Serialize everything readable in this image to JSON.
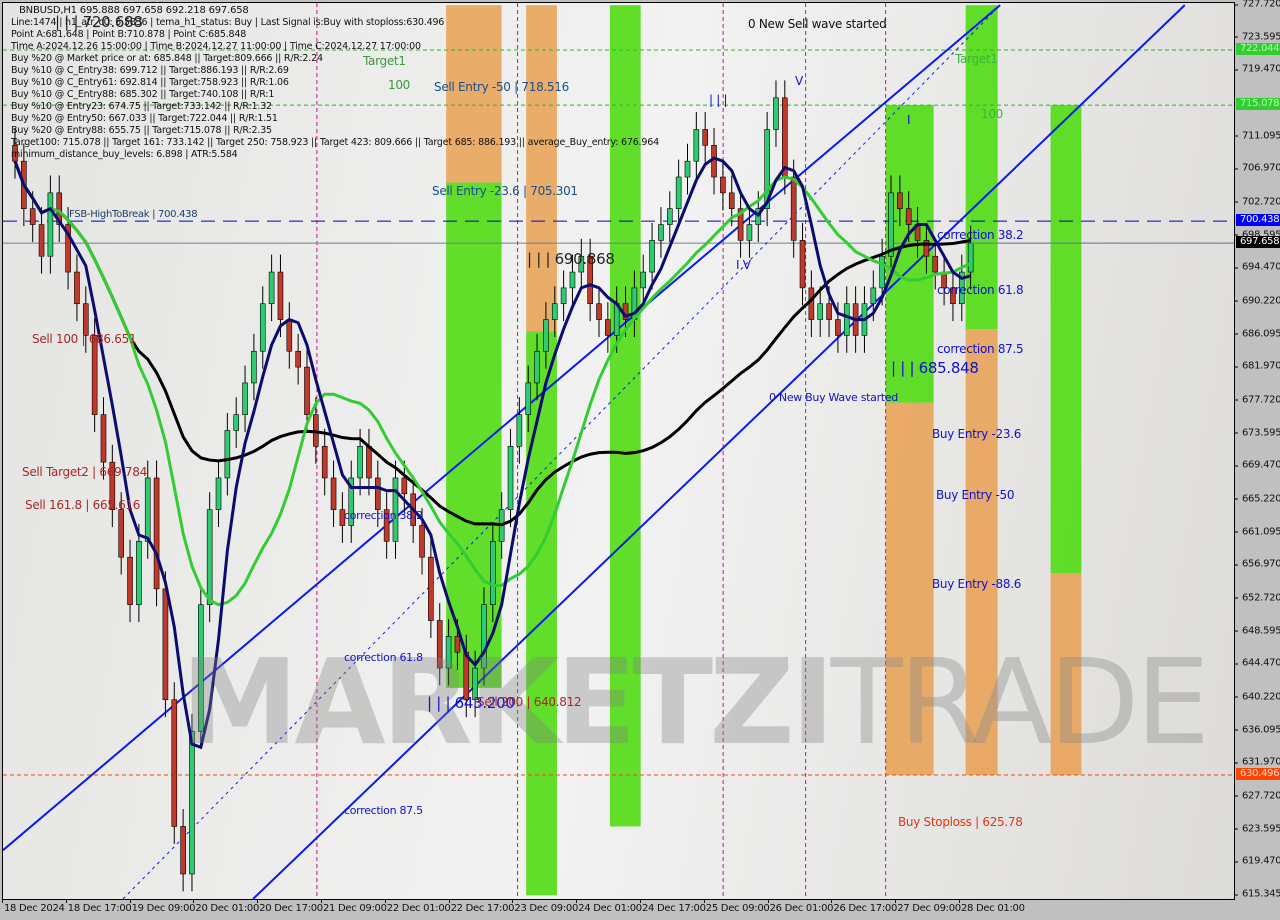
{
  "chart_data": {
    "type": "candlestick",
    "title": "BNBUSD,H1  695.888 697.658 692.218 697.658",
    "symbol": "BNBUSD",
    "timeframe": "H1",
    "ohlc_current": {
      "open": 695.888,
      "high": 697.658,
      "low": 692.218,
      "close": 697.658
    },
    "ylim": [
      615.345,
      727.72
    ],
    "y_ticks": [
      "727.720",
      "723.595",
      "719.470",
      "711.095",
      "706.970",
      "702.720",
      "698.595",
      "694.470",
      "690.220",
      "686.095",
      "681.970",
      "677.720",
      "673.595",
      "669.470",
      "665.220",
      "661.095",
      "656.970",
      "652.720",
      "648.595",
      "644.470",
      "640.220",
      "636.095",
      "631.970",
      "627.720",
      "623.595",
      "619.470",
      "615.345"
    ],
    "x_ticks": [
      "18 Dec 2024",
      "18 Dec 17:00",
      "19 Dec 09:00",
      "20 Dec 01:00",
      "20 Dec 17:00",
      "21 Dec 09:00",
      "22 Dec 01:00",
      "22 Dec 17:00",
      "23 Dec 09:00",
      "24 Dec 01:00",
      "24 Dec 17:00",
      "25 Dec 09:00",
      "26 Dec 01:00",
      "26 Dec 17:00",
      "27 Dec 09:00",
      "28 Dec 01:00"
    ],
    "price_badges": [
      {
        "value": "722.044",
        "color": "#33cc33",
        "text_color": "#aaffaa"
      },
      {
        "value": "715.078",
        "color": "#33cc33",
        "text_color": "#aaffaa"
      },
      {
        "value": "700.438",
        "color": "#0000ff",
        "text_color": "#ffffff"
      },
      {
        "value": "697.658",
        "color": "#000000",
        "text_color": "#ffffff"
      },
      {
        "value": "630.496",
        "color": "#ff4400",
        "text_color": "#ffdddd"
      }
    ],
    "horizontal_lines": [
      {
        "name": "target-722",
        "value": 722.044,
        "color": "#22bb22",
        "style": "dashed"
      },
      {
        "name": "target-715",
        "value": 715.078,
        "color": "#22bb22",
        "style": "dashed"
      },
      {
        "name": "fsb-high-to-break",
        "value": 700.438,
        "color": "#0000cc",
        "style": "longdash"
      },
      {
        "name": "last-price",
        "value": 697.658,
        "color": "#708090",
        "style": "solid"
      },
      {
        "name": "stoploss",
        "value": 630.496,
        "color": "#ff4400",
        "style": "dashed"
      }
    ],
    "close_series_approx": [
      708,
      702,
      700,
      696,
      704,
      700,
      694,
      690,
      686,
      676,
      670,
      664,
      658,
      652,
      660,
      668,
      654,
      640,
      624,
      618,
      636,
      652,
      664,
      668,
      674,
      676,
      680,
      684,
      690,
      694,
      688,
      684,
      682,
      676,
      672,
      668,
      664,
      662,
      668,
      672,
      668,
      664,
      660,
      668,
      666,
      662,
      658,
      650,
      644,
      648,
      646,
      640,
      644,
      652,
      660,
      664,
      672,
      676,
      680,
      684,
      688,
      690,
      692,
      694,
      696,
      690,
      688,
      686,
      690,
      688,
      692,
      694,
      698,
      700,
      702,
      706,
      708,
      712,
      710,
      706,
      704,
      702,
      698,
      700,
      702,
      712,
      716,
      706,
      698,
      692,
      688,
      690,
      688,
      686,
      690,
      686,
      690,
      692,
      696,
      704,
      702,
      700,
      698,
      696,
      694,
      692,
      690,
      694,
      697.658
    ],
    "zones": [
      {
        "name": "sell-zone-1",
        "color": "orange",
        "from_x": 0.36,
        "to_x": 0.405,
        "from_y": 727.7,
        "to_y": 705.3
      },
      {
        "name": "sell-zone-1-green",
        "color": "green",
        "from_x": 0.36,
        "to_x": 0.405,
        "from_y": 705.3,
        "to_y": 641.5
      },
      {
        "name": "sell-zone-2",
        "color": "orange",
        "from_x": 0.425,
        "to_x": 0.45,
        "from_y": 727.7,
        "to_y": 686.5
      },
      {
        "name": "sell-zone-2-green",
        "color": "green",
        "from_x": 0.425,
        "to_x": 0.45,
        "from_y": 686.5,
        "to_y": 615.3
      },
      {
        "name": "green-band-3",
        "color": "green",
        "from_x": 0.493,
        "to_x": 0.518,
        "from_y": 727.7,
        "to_y": 624
      },
      {
        "name": "buy-zone-1-green",
        "color": "green",
        "from_x": 0.717,
        "to_x": 0.756,
        "from_y": 715.1,
        "to_y": 677.5
      },
      {
        "name": "buy-zone-1",
        "color": "orange",
        "from_x": 0.717,
        "to_x": 0.756,
        "from_y": 677.5,
        "to_y": 630.5
      },
      {
        "name": "buy-zone-2-green",
        "color": "green",
        "from_x": 0.782,
        "to_x": 0.808,
        "from_y": 727.7,
        "to_y": 686.8
      },
      {
        "name": "buy-zone-2",
        "color": "orange",
        "from_x": 0.782,
        "to_x": 0.808,
        "from_y": 686.8,
        "to_y": 630.5
      },
      {
        "name": "buy-zone-3-green",
        "color": "green",
        "from_x": 0.851,
        "to_x": 0.876,
        "from_y": 715.1,
        "to_y": 656
      },
      {
        "name": "buy-zone-3",
        "color": "orange",
        "from_x": 0.851,
        "to_x": 0.876,
        "from_y": 656,
        "to_y": 630.5
      }
    ]
  },
  "info_panel": {
    "line1": "Line:1474 | h1_atr_c0: 5.5836 | tema_h1_status: Buy | Last Signal is:Buy with stoploss:630.496",
    "line2": "Point A:681.648 | Point B:710.878 | Point C:685.848",
    "line3": "Time A:2024.12.26 15:00:00 | Time B:2024.12.27 11:00:00 | Time C:2024.12.27 17:00:00",
    "line4": "Buy %20 @ Market price or at: 685.848 || Target:809.666 || R/R:2.24",
    "line5": "Buy %10 @ C_Entry38: 699.712 || Target:886.193 || R/R:2.69",
    "line6": "Buy %10 @ C_Entry61: 692.814 || Target:758.923 || R/R:1.06",
    "line7": "Buy %10 @ C_Entry88: 685.302 || Target:740.108 || R/R:1",
    "line8": "Buy %10 @ Entry23: 674.75 || Target:733.142 || R/R:1.32",
    "line9": "Buy %20 @ Entry50: 667.033 || Target:722.044 || R/R:1.51",
    "line10": "Buy %20 @ Entry88: 655.75 || Target:715.078 || R/R:2.35",
    "line11": "Target100: 715.078 || Target 161: 733.142 || Target 250: 758.923 || Target 423: 809.666 || Target 685: 886.193 || average_Buy_entry: 676.964",
    "line12": "minimum_distance_buy_levels: 6.898 | ATR:5.584"
  },
  "labels": {
    "top_wave_label": "| | | 720.688",
    "target1_left": "Target1",
    "target1_right": "Target1",
    "level100_left": "100",
    "level100_right": "100",
    "sell_entry_50": "Sell Entry -50 | 718.516",
    "sell_entry_23": "Sell Entry -23.6 | 705.301",
    "fsb_high": "FSB-HighToBreak | 700.438",
    "wave_690": "| | | 690.868",
    "sell_100": "Sell 100 | 686.651",
    "sell_target2": "Sell Target2 | 669.784",
    "sell_161": "Sell 161.8 | 665.616",
    "correction_382_left": "correction 38.2",
    "correction_618_left": "correction 61.8",
    "correction_875_left": "correction 87.5",
    "wave_643": "| | | 643.200",
    "sell_200": "Sell 200 | 640.812",
    "new_sell_wave": "0 New Sell wave started",
    "new_buy_wave": "0 New Buy Wave started",
    "correction_382_right": "correction 38.2",
    "correction_618_right": "correction 61.8",
    "correction_875_right": "correction 87.5",
    "wave_685": "| | | 685.848",
    "buy_entry_23": "Buy Entry -23.6",
    "buy_entry_50": "Buy Entry -50",
    "buy_entry_88": "Buy Entry -88.6",
    "buy_stoploss": "Buy Stoploss | 625.78",
    "wave_marker_iii": "| | |",
    "wave_marker_iv": "I V",
    "wave_marker_v": "V",
    "wave_marker_i": "I"
  },
  "watermark": {
    "bold": "MARKETZI",
    "thin": "TRADE"
  }
}
